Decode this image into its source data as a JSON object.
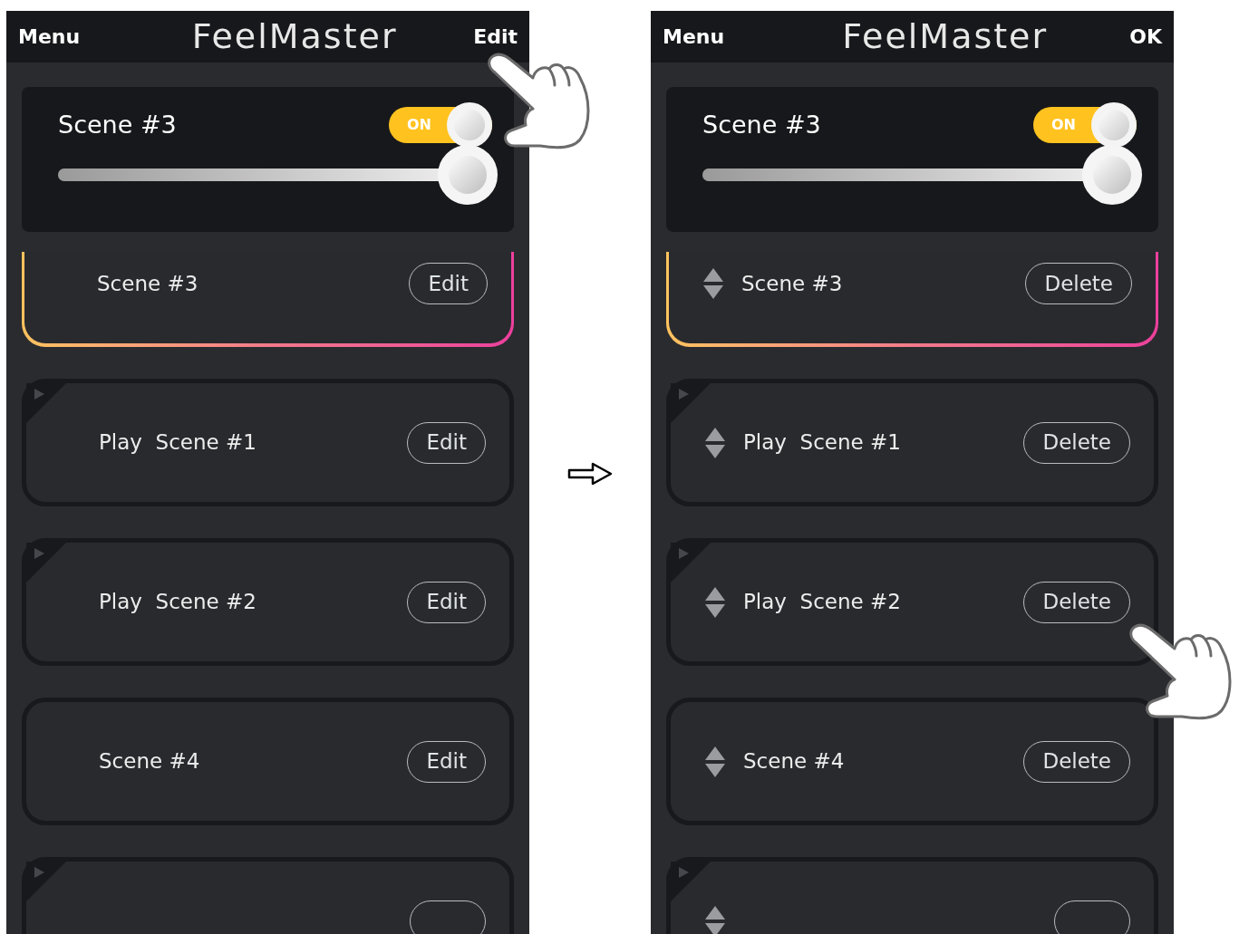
{
  "screens": [
    {
      "header": {
        "left": "Menu",
        "title": "FeelMaster",
        "right": "Edit",
        "right_tapped": true
      },
      "now_playing": {
        "title": "Scene #3",
        "toggle": {
          "label": "ON",
          "on": true
        },
        "slider": {
          "level": 1
        }
      },
      "reorderable": false,
      "scenes": [
        {
          "label": "Scene #3",
          "selected": true,
          "playable": false,
          "action": "Edit",
          "tapped": false
        },
        {
          "label": "Play  Scene #1",
          "selected": false,
          "playable": true,
          "action": "Edit",
          "tapped": false
        },
        {
          "label": "Play  Scene #2",
          "selected": false,
          "playable": true,
          "action": "Edit",
          "tapped": false
        },
        {
          "label": "Scene #4",
          "selected": false,
          "playable": false,
          "action": "Edit",
          "tapped": false
        },
        {
          "selected": false,
          "playable": true
        }
      ]
    },
    {
      "header": {
        "left": "Menu",
        "title": "FeelMaster",
        "right": "OK",
        "right_tapped": false
      },
      "now_playing": {
        "title": "Scene #3",
        "toggle": {
          "label": "ON",
          "on": true
        },
        "slider": {
          "level": 1
        }
      },
      "reorderable": true,
      "scenes": [
        {
          "label": "Scene #3",
          "selected": true,
          "playable": false,
          "action": "Delete",
          "tapped": false
        },
        {
          "label": "Play  Scene #1",
          "selected": false,
          "playable": true,
          "action": "Delete",
          "tapped": false
        },
        {
          "label": "Play  Scene #2",
          "selected": false,
          "playable": true,
          "action": "Delete",
          "tapped": true
        },
        {
          "label": "Scene #4",
          "selected": false,
          "playable": false,
          "action": "Delete",
          "tapped": false
        },
        {
          "selected": false,
          "playable": true
        }
      ]
    }
  ]
}
